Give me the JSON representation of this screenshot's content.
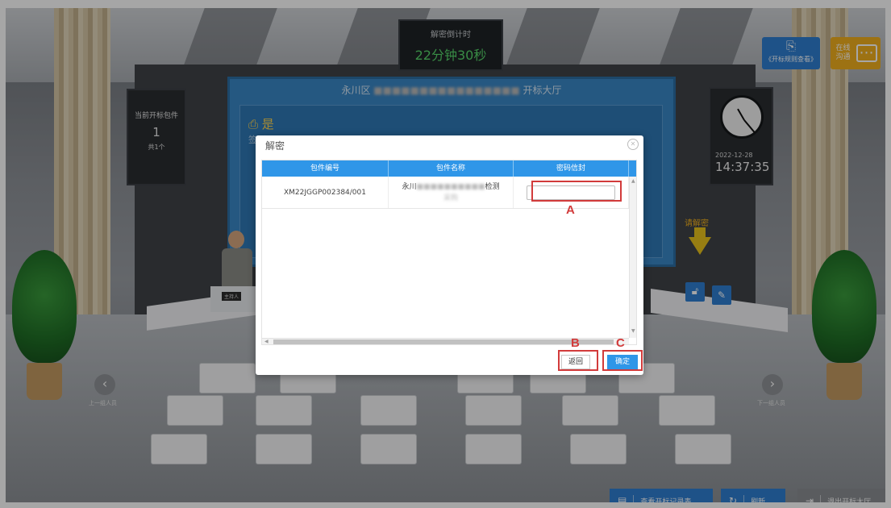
{
  "scene": {
    "timer_label": "解密倒计时",
    "timer_value": "22分钟30秒",
    "hall_title_prefix": "永川区",
    "hall_title_suffix": "开标大厅",
    "screen_status": "是",
    "screen_substatus": "签到",
    "left_board": {
      "title": "当前开标包件",
      "count": "1",
      "total": "共1个"
    },
    "clock": {
      "date": "2022-12-28",
      "time": "14:37:35"
    },
    "rule_button": "《开标规则查看》",
    "chat_button": "在线沟通",
    "host_label": "主持人",
    "prev_label": "上一组人员",
    "next_label": "下一组人员",
    "decrypt_hint": "请解密",
    "bottom": {
      "record_label": "查看开标记录表",
      "refresh_label": "刷新",
      "exit_label": "退出开标大厅"
    }
  },
  "modal": {
    "title": "解密",
    "columns": [
      "包件编号",
      "包件名称",
      "密码信封"
    ],
    "rows": [
      {
        "code": "XM22JGGP002384/001",
        "name_visible_prefix": "永川",
        "name_visible_suffix": "检测",
        "name_line2": "采购",
        "password": ""
      }
    ],
    "back_label": "返回",
    "confirm_label": "确定"
  },
  "callouts": {
    "a": "A",
    "b": "B",
    "c": "C"
  },
  "colors": {
    "accent": "#2f96e8",
    "callout": "#d23b3b",
    "timer_green": "#57d66a",
    "chat_yellow": "#f2b01e"
  }
}
